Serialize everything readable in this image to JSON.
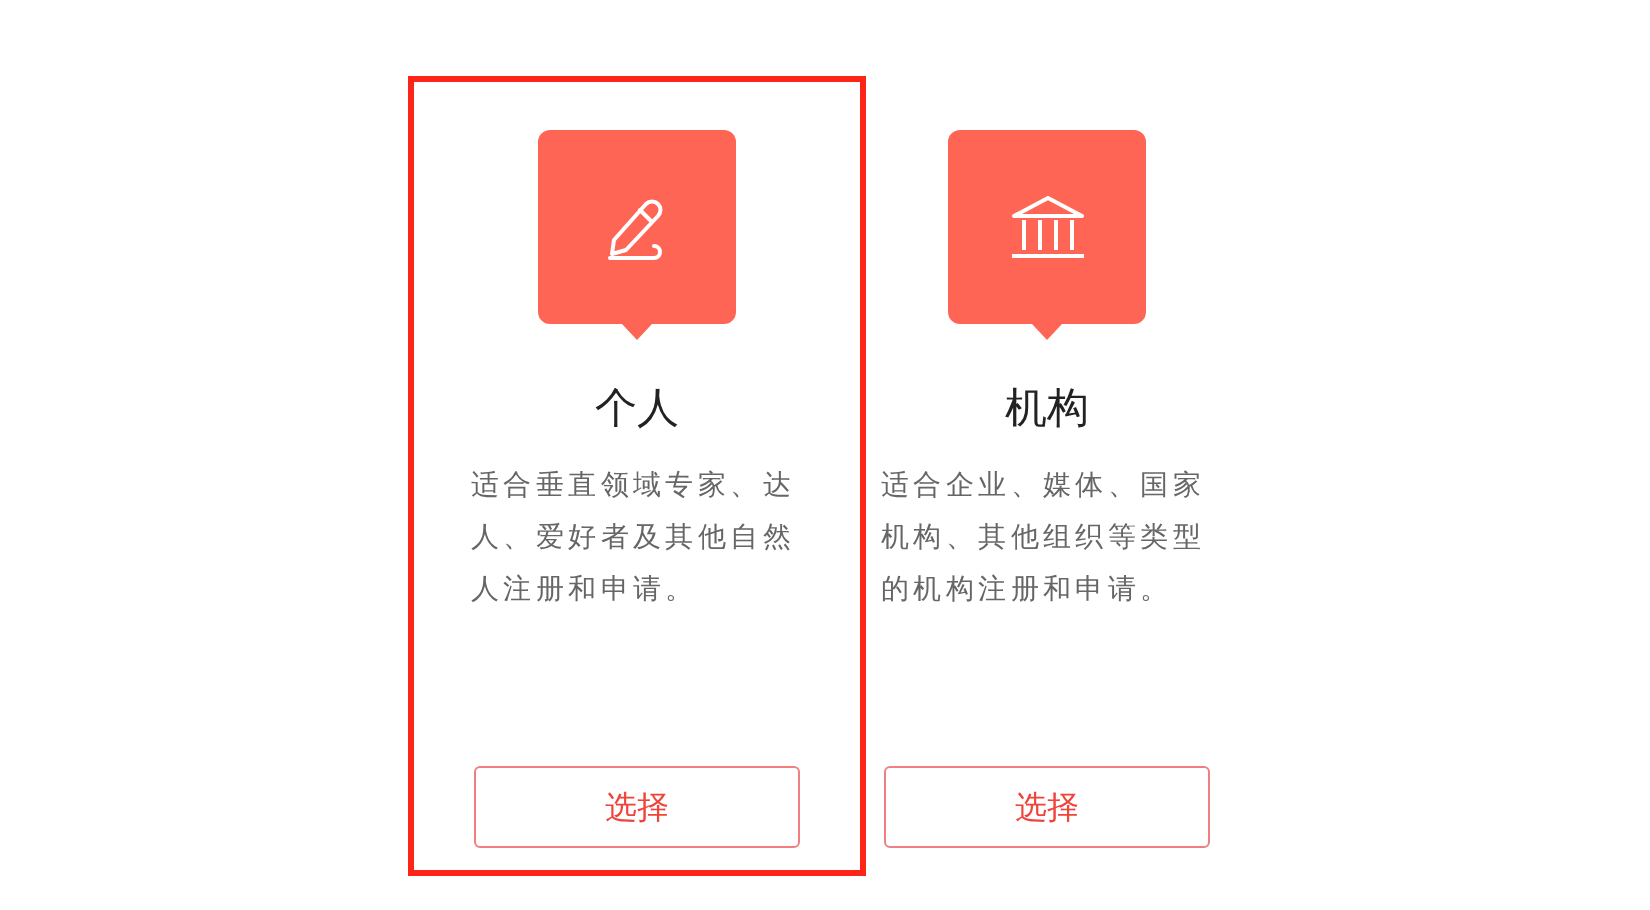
{
  "cards": [
    {
      "kind": "pen",
      "title": "个人",
      "description": "适合垂直领域专家、达人、爱好者及其他自然人注册和申请。",
      "button": "选择",
      "selected": true
    },
    {
      "kind": "bank",
      "title": "机构",
      "description": "适合企业、媒体、国家机构、其他组织等类型的机构注册和申请。",
      "button": "选择",
      "selected": false
    }
  ]
}
